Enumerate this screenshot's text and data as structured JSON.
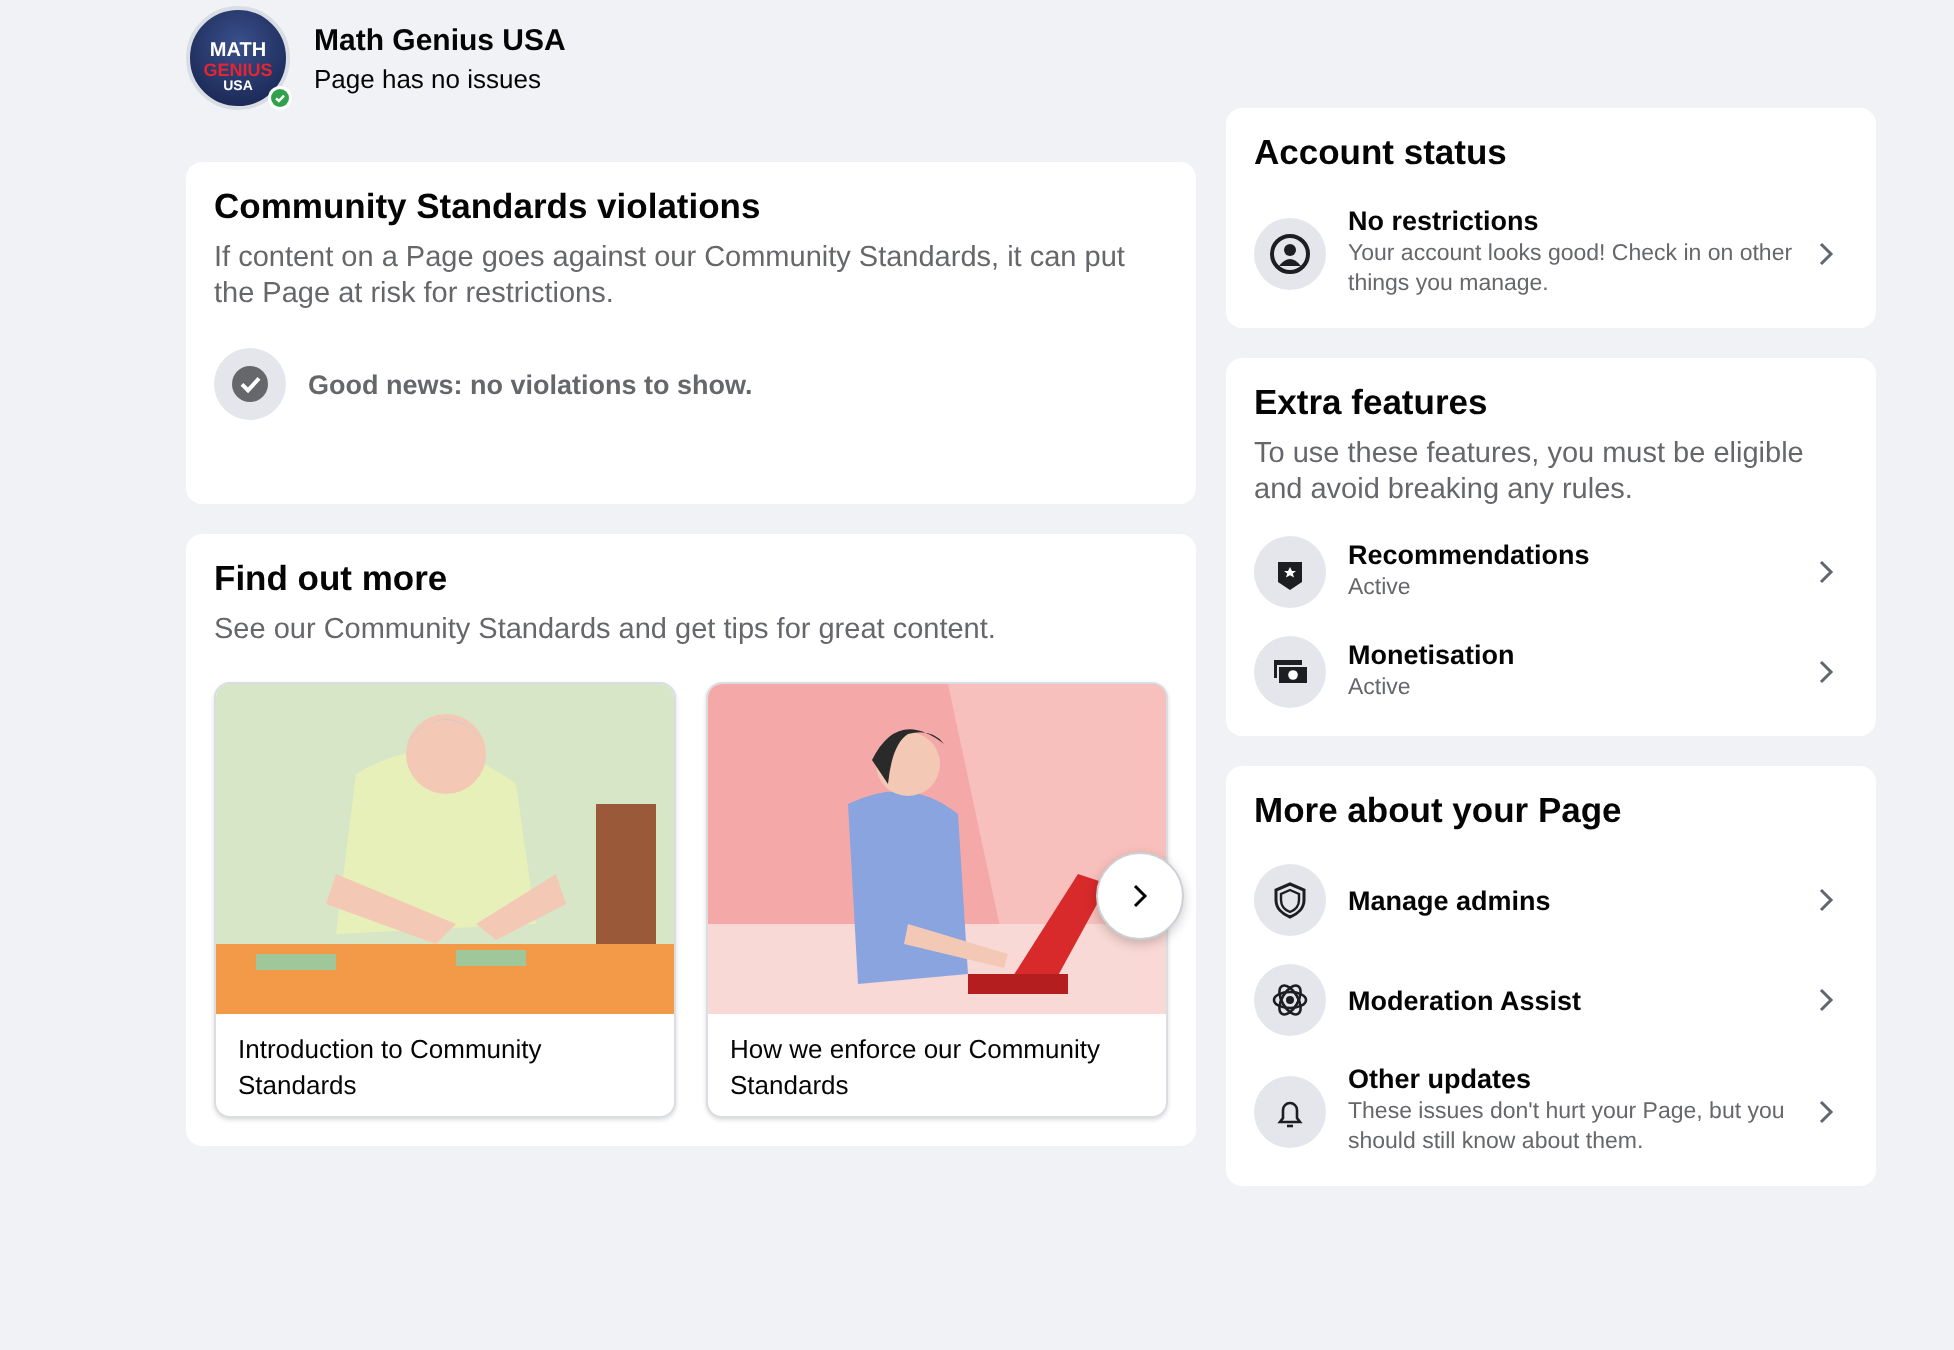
{
  "page": {
    "logo_lines": [
      "MATH",
      "GENIUS",
      "USA"
    ],
    "verified": true,
    "name": "Math Genius USA",
    "status": "Page has no issues"
  },
  "violations": {
    "title": "Community Standards violations",
    "description": "If content on a Page goes against our Community Standards, it can put the Page at risk for restrictions.",
    "result": "Good news: no violations to show."
  },
  "find_out_more": {
    "title": "Find out more",
    "description": "See our Community Standards and get tips for great content.",
    "articles": [
      {
        "caption": "Introduction to Community Standards"
      },
      {
        "caption": "How we enforce our Community Standards"
      }
    ]
  },
  "account_status": {
    "title": "Account status",
    "items": [
      {
        "title": "No restrictions",
        "subtitle": "Your account looks good! Check in on other things you manage."
      }
    ]
  },
  "extra_features": {
    "title": "Extra features",
    "description": "To use these features, you must be eligible and avoid breaking any rules.",
    "items": [
      {
        "title": "Recommendations",
        "subtitle": "Active"
      },
      {
        "title": "Monetisation",
        "subtitle": "Active"
      }
    ]
  },
  "more_about": {
    "title": "More about your Page",
    "items": [
      {
        "title": "Manage admins"
      },
      {
        "title": "Moderation Assist"
      },
      {
        "title": "Other updates",
        "subtitle": "These issues don't hurt your Page, but you should still know about them."
      }
    ]
  }
}
